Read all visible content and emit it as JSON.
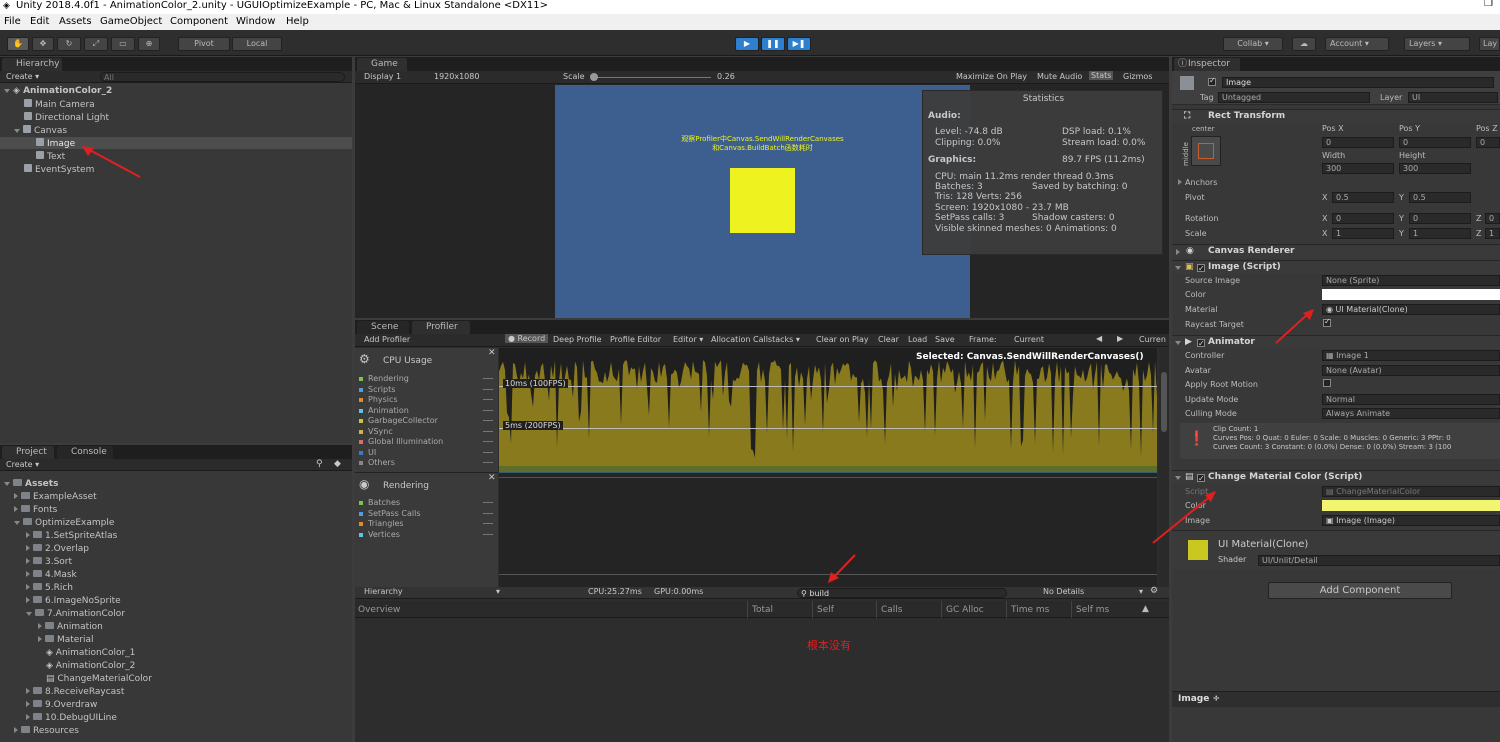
{
  "window_title": "Unity 2018.4.0f1 - AnimationColor_2.unity - UGUIOptimizeExample - PC, Mac & Linux Standalone <DX11>",
  "menu": [
    "File",
    "Edit",
    "Assets",
    "GameObject",
    "Component",
    "Window",
    "Help"
  ],
  "toolbar": {
    "pivot": "Pivot",
    "local": "Local",
    "collab": "Collab ▾",
    "account": "Account",
    "layers": "Layers",
    "layout": "Lay"
  },
  "hierarchy": {
    "tab": "Hierarchy",
    "create": "Create ▾",
    "search_placeholder": "All",
    "scene": "AnimationColor_2",
    "items": [
      "Main Camera",
      "Directional Light",
      "Canvas",
      "Image",
      "Text",
      "EventSystem"
    ]
  },
  "project": {
    "tabs": [
      "Project",
      "Console"
    ],
    "create": "Create ▾",
    "root": "Assets",
    "items": [
      "ExampleAsset",
      "Fonts",
      "OptimizeExample",
      "1.SetSpriteAtlas",
      "2.Overlap",
      "3.Sort",
      "4.Mask",
      "5.Rich",
      "6.ImageNoSprite",
      "7.AnimationColor",
      "Animation",
      "Material",
      "AnimationColor_1",
      "AnimationColor_2",
      "ChangeMaterialColor",
      "8.ReceiveRaycast",
      "9.Overdraw",
      "10.DebugUILine",
      "Resources"
    ]
  },
  "game": {
    "tab": "Game",
    "display": "Display 1",
    "resolution": "1920x1080",
    "scale_label": "Scale",
    "scale_value": "0.26",
    "buttons": [
      "Maximize On Play",
      "Mute Audio",
      "Stats",
      "Gizmos"
    ],
    "overlay_line1": "观察Profiler中Canvas.SendWillRenderCanvases",
    "overlay_line2": "和Canvas.BuildBatch函数耗时",
    "stats": {
      "title": "Statistics",
      "audio": "Audio:",
      "level": "Level: -74.8 dB",
      "dsp": "DSP load: 0.1%",
      "clipping": "Clipping: 0.0%",
      "stream": "Stream load: 0.0%",
      "graphics": "Graphics:",
      "fps": "89.7 FPS (11.2ms)",
      "cpu": "CPU: main 11.2ms  render thread 0.3ms",
      "batches": "Batches: 3",
      "saved": "Saved by batching: 0",
      "tris": "Tris: 128  Verts: 256",
      "screen": "Screen: 1920x1080 - 23.7 MB",
      "setpass": "SetPass calls: 3",
      "shadow": "Shadow casters: 0",
      "skinned": "Visible skinned meshes: 0  Animations: 0"
    }
  },
  "profiler": {
    "tabs": [
      "Scene",
      "Profiler"
    ],
    "add": "Add Profiler",
    "buttons": [
      "Record",
      "Deep Profile",
      "Profile Editor",
      "Editor ▾",
      "Allocation Callstacks ▾",
      "Clear on Play",
      "Clear",
      "Load",
      "Save",
      "Frame:",
      "Current",
      "Curren"
    ],
    "cpu_title": "CPU Usage",
    "cpu_items": [
      "Rendering",
      "Scripts",
      "Physics",
      "Animation",
      "GarbageCollector",
      "VSync",
      "Global Illumination",
      "UI",
      "Others"
    ],
    "cpu_colors": [
      "#7fc250",
      "#4f9edb",
      "#e38a2d",
      "#5ec3dc",
      "#c6c73b",
      "#d2b33f",
      "#d56f6f",
      "#3a7bc8",
      "#888888"
    ],
    "render_title": "Rendering",
    "render_items": [
      "Batches",
      "SetPass Calls",
      "Triangles",
      "Vertices"
    ],
    "render_colors": [
      "#7fc250",
      "#4f9edb",
      "#e38a2d",
      "#5ec3dc"
    ],
    "selected": "Selected: Canvas.SendWillRenderCanvases()",
    "line_100": "10ms (100FPS)",
    "line_200": "5ms (200FPS)",
    "bottom": {
      "view": "Hierarchy",
      "cpu": "CPU:25.27ms",
      "gpu": "GPU:0.00ms",
      "search": "build",
      "details": "No Details"
    },
    "columns": [
      "Overview",
      "Total",
      "Self",
      "Calls",
      "GC Alloc",
      "Time ms",
      "Self ms"
    ],
    "empty_note": "根本没有"
  },
  "inspector": {
    "tab": "Inspector",
    "object": "Image",
    "tag_label": "Tag",
    "tag": "Untagged",
    "layer_label": "Layer",
    "layer": "UI",
    "rect": {
      "title": "Rect Transform",
      "anchor_h": "center",
      "anchor_v": "middle",
      "posx_l": "Pos X",
      "posy_l": "Pos Y",
      "posz_l": "Pos Z",
      "posx": "0",
      "posy": "0",
      "posz": "0",
      "width_l": "Width",
      "height_l": "Height",
      "width": "300",
      "height": "300",
      "anchors": "Anchors",
      "pivot": "Pivot",
      "pivot_x": "0.5",
      "pivot_y": "0.5",
      "rotation": "Rotation",
      "rot_x": "0",
      "rot_y": "0",
      "rot_z": "0",
      "scale": "Scale",
      "scale_x": "1",
      "scale_y": "1",
      "scale_z": "1",
      "x": "X",
      "y": "Y",
      "z": "Z"
    },
    "canvas_renderer": "Canvas Renderer",
    "image_script": {
      "title": "Image (Script)",
      "source_l": "Source Image",
      "source": "None (Sprite)",
      "color_l": "Color",
      "material_l": "Material",
      "material": "UI Material(Clone)",
      "raycast_l": "Raycast Target"
    },
    "animator": {
      "title": "Animator",
      "controller_l": "Controller",
      "controller": "Image 1",
      "avatar_l": "Avatar",
      "avatar": "None (Avatar)",
      "root_l": "Apply Root Motion",
      "update_l": "Update Mode",
      "update": "Normal",
      "culling_l": "Culling Mode",
      "culling": "Always Animate",
      "info1": "Clip Count: 1",
      "info2": "Curves Pos: 0 Quat: 0 Euler: 0 Scale: 0 Muscles: 0 Generic: 3 PPtr: 0",
      "info3": "Curves Count: 3 Constant: 0 (0.0%) Dense: 0 (0.0%) Stream: 3 (100"
    },
    "change_color": {
      "title": "Change Material Color (Script)",
      "script_l": "Script",
      "script": "ChangeMaterialColor",
      "color_l": "Color",
      "image_l": "Image",
      "image": "Image (Image)"
    },
    "material": {
      "name": "UI Material(Clone)",
      "shader_l": "Shader",
      "shader": "UI/Unlit/Detail"
    },
    "add_component": "Add Component",
    "preview": "Image ÷"
  },
  "colors": {
    "game_bg": "#3c5f90",
    "yellow": "#eef31f",
    "annotation": "#e02020",
    "accent_blue": "#2f7fcf"
  }
}
